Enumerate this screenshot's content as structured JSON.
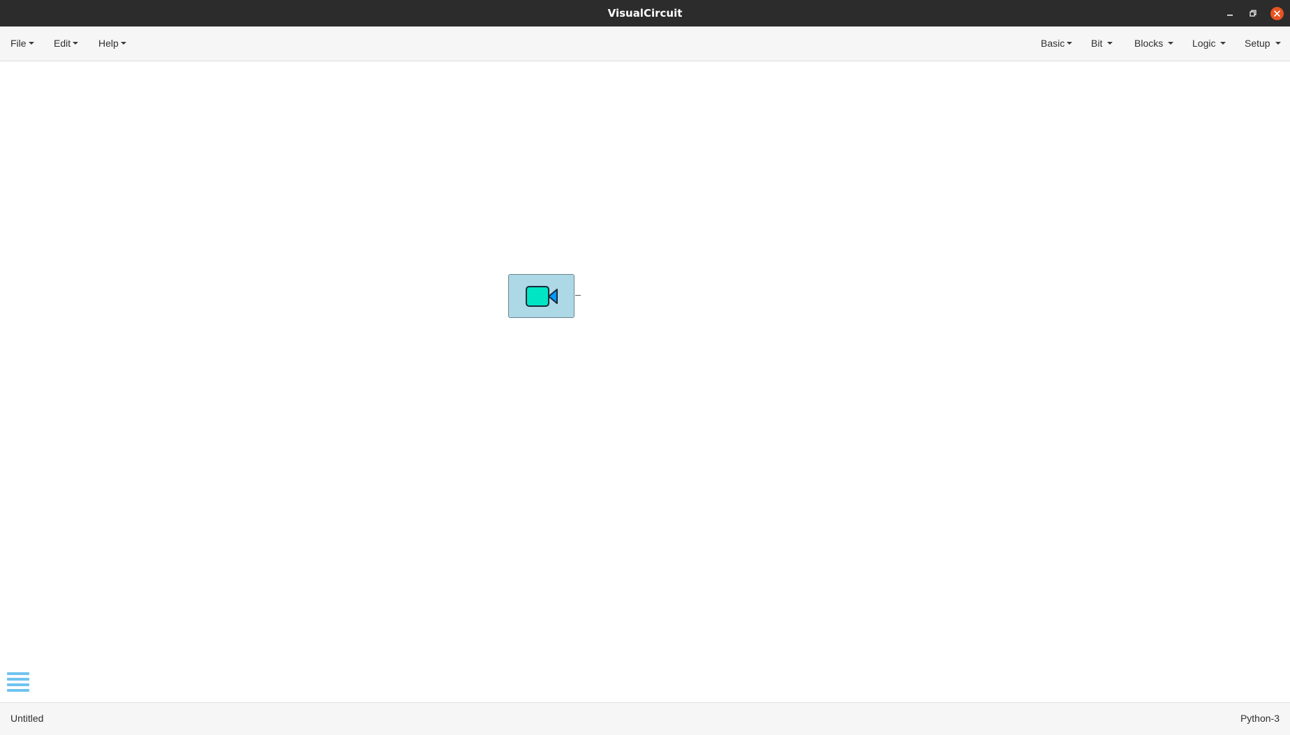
{
  "window": {
    "title": "VisualCircuit"
  },
  "menubar": {
    "left": [
      {
        "label": "File"
      },
      {
        "label": "Edit"
      },
      {
        "label": "Help"
      }
    ],
    "right": [
      {
        "label": "Basic"
      },
      {
        "label": "Bit"
      },
      {
        "label": "Blocks"
      },
      {
        "label": "Logic"
      },
      {
        "label": "Setup"
      }
    ]
  },
  "canvas": {
    "block": {
      "icon": "video-camera-icon",
      "block_fill": "#add8e6",
      "icon_fill": "#00e5c4",
      "icon_lens_fill": "#0099ff"
    },
    "menu_button_icon": "hamburger-menu-icon"
  },
  "statusbar": {
    "filename": "Untitled",
    "language": "Python-3"
  },
  "colors": {
    "titlebar": "#2c2c2c",
    "close_button": "#e95420",
    "menubar": "#f6f6f7",
    "hamburger": "#6fc3f0"
  }
}
